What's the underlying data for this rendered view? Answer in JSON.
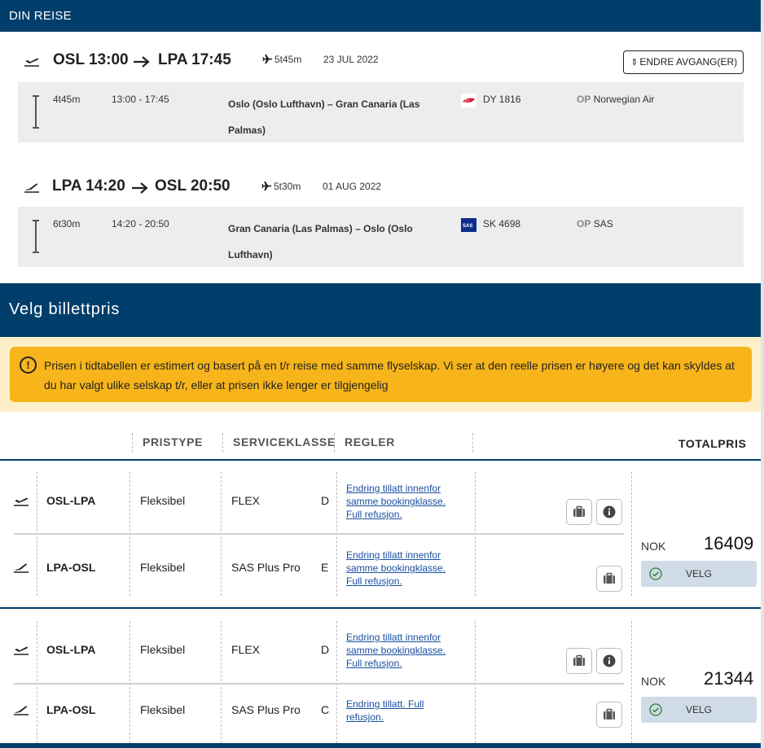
{
  "trip": {
    "header": "DIN REISE",
    "change_button": "ENDRE AVGANG(ER)",
    "legs": [
      {
        "route_from": "OSL 13:00",
        "route_to": "LPA 17:45",
        "icon": "plane-takeoff-icon",
        "duration": "5t45m",
        "date": "23 JUL 2022",
        "segment": {
          "duration": "4t45m",
          "times": "13:00 - 17:45",
          "description": "Oslo (Oslo Lufthavn) – Gran Canaria (Las Palmas)",
          "flight": "DY 1816",
          "op_label": "OP",
          "operator": "Norwegian Air",
          "airline_logo": "norwegian-logo"
        }
      },
      {
        "route_from": "LPA 14:20",
        "route_to": "OSL 20:50",
        "icon": "plane-landing-icon",
        "duration": "5t30m",
        "date": "01 AUG 2022",
        "segment": {
          "duration": "6t30m",
          "times": "14:20 - 20:50",
          "description": "Gran Canaria (Las Palmas) – Oslo (Oslo Lufthavn)",
          "flight": "SK 4698",
          "op_label": "OP",
          "operator": "SAS",
          "airline_logo": "sas-logo"
        }
      }
    ]
  },
  "pricing": {
    "title": "Velg billettpris",
    "warning": "Prisen i tidtabellen er estimert og basert på en t/r reise med samme flyselskap. Vi ser at den reelle prisen er høyere og det kan skyldes at du har valgt ulike selskap t/r, eller at prisen ikke lenger er tilgjengelig",
    "columns": {
      "pristype": "PRISTYPE",
      "serviceklasse": "SERVICEKLASSE",
      "regler": "REGLER",
      "totalpris": "TOTALPRIS"
    },
    "options": [
      {
        "currency": "NOK",
        "total": "16409",
        "select_label": "VELG",
        "rows": [
          {
            "route": "OSL-LPA",
            "type": "Fleksibel",
            "class": "FLEX",
            "code": "D",
            "rules": "Endring tillatt innenfor samme bookingklasse. Full refusjon."
          },
          {
            "route": "LPA-OSL",
            "type": "Fleksibel",
            "class": "SAS Plus Pro",
            "code": "E",
            "rules": "Endring tillatt innenfor samme bookingklasse. Full refusjon."
          }
        ]
      },
      {
        "currency": "NOK",
        "total": "21344",
        "select_label": "VELG",
        "rows": [
          {
            "route": "OSL-LPA",
            "type": "Fleksibel",
            "class": "FLEX",
            "code": "D",
            "rules": "Endring tillatt innenfor samme bookingklasse. Full refusjon."
          },
          {
            "route": "LPA-OSL",
            "type": "Fleksibel",
            "class": "SAS Plus Pro",
            "code": "C",
            "rules": "Endring tillatt. Full refusjon."
          }
        ]
      }
    ]
  },
  "colors": {
    "navy": "#023e6b",
    "warning": "#f7b51b",
    "warning_bg": "#fdf0c9",
    "segment_bg": "#ededed",
    "velg_bg": "#cfdbe6"
  }
}
